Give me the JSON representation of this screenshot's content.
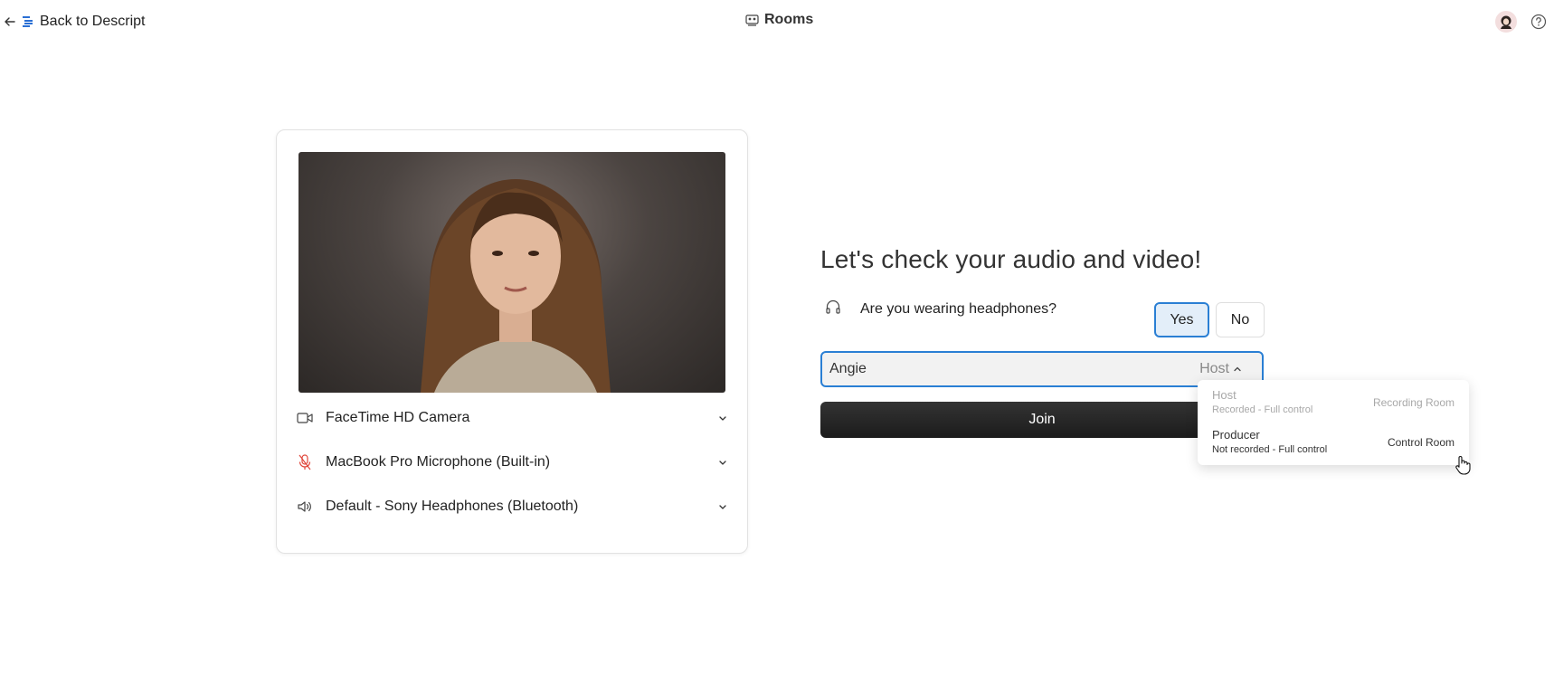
{
  "topbar": {
    "back_label": "Back to Descript",
    "title": "Rooms"
  },
  "devices": [
    {
      "label": "FaceTime HD Camera",
      "icon": "camera-icon"
    },
    {
      "label": "MacBook Pro Microphone (Built-in)",
      "icon": "microphone-muted-icon"
    },
    {
      "label": "Default - Sony Headphones (Bluetooth)",
      "icon": "speaker-icon"
    }
  ],
  "check": {
    "heading": "Let's check your audio and video!",
    "headphones_question": "Are you wearing headphones?",
    "yes_label": "Yes",
    "no_label": "No",
    "selected": "Yes"
  },
  "name_field": {
    "value": "Angie",
    "role": "Host"
  },
  "join_label": "Join",
  "role_menu": [
    {
      "name": "Host",
      "desc": "Recorded - Full control",
      "room": "Recording Room"
    },
    {
      "name": "Producer",
      "desc": "Not recorded - Full control",
      "room": "Control Room"
    }
  ],
  "colors": {
    "accent": "#2a7fd4",
    "mic_muted": "#e0453a",
    "join_bg": "#222222"
  }
}
